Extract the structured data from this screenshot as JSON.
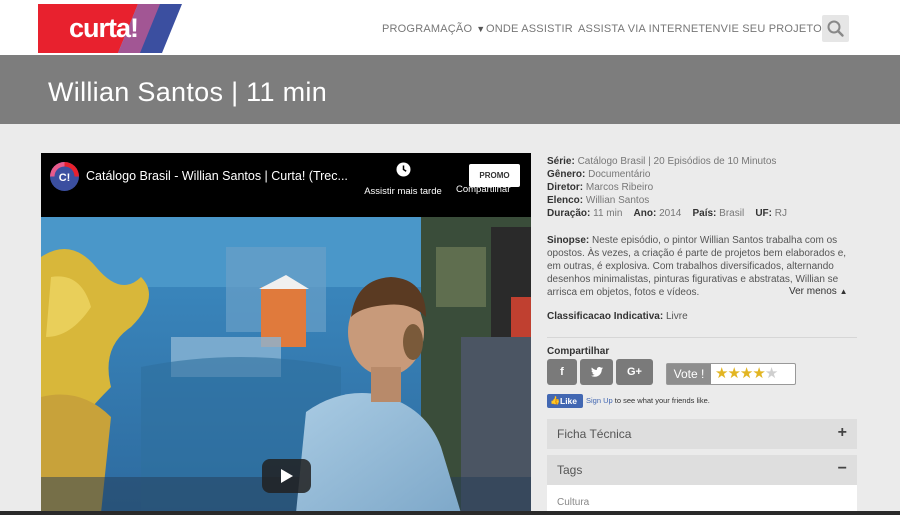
{
  "header": {
    "logo_text": "curta!",
    "nav": [
      "PROGRAMAÇÃO",
      "ONDE ASSISTIR",
      "ASSISTA VIA INTERNET",
      "ENVIE SEU PROJETO"
    ],
    "search_icon": "search-icon"
  },
  "page": {
    "title": "Willian Santos | 11 min"
  },
  "video": {
    "channel_icon_text": "C!",
    "title": "Catálogo Brasil - Willian Santos | Curta! (Trec...",
    "watch_later": "Assistir mais tarde",
    "promo": "PROMO",
    "share": "Compartilhar"
  },
  "info": {
    "serie_label": "Série:",
    "serie": "Catálogo Brasil | 20 Episódios de 10 Minutos",
    "genero_label": "Gênero:",
    "genero": "Documentário",
    "diretor_label": "Diretor:",
    "diretor": "Marcos Ribeiro",
    "elenco_label": "Elenco:",
    "elenco": "Willian Santos",
    "duracao_label": "Duração:",
    "duracao": "11 min",
    "ano_label": "Ano:",
    "ano": "2014",
    "pais_label": "País:",
    "pais": "Brasil",
    "uf_label": "UF:",
    "uf": "RJ"
  },
  "synopsis": {
    "label": "Sinopse:",
    "text": "Neste episódio, o pintor Willian Santos trabalha com os opostos. Às vezes, a criação é parte de projetos bem elaborados e, em outras, é explosiva. Com trabalhos diversificados, alternando desenhos minimalistas, pinturas figurativas e abstratas, Willian se arrisca em objetos, fotos e vídeos.",
    "toggle": "Ver menos"
  },
  "classification": {
    "label": "Classificacao Indicativa:",
    "value": "Livre"
  },
  "share": {
    "title": "Compartilhar",
    "facebook": "f",
    "twitter": "twitter-icon",
    "google": "G+"
  },
  "vote": {
    "label": "Vote !",
    "rating": 4,
    "max": 5
  },
  "facebook_like": {
    "button": "Like",
    "signup": "Sign Up",
    "text": " to see what your friends like."
  },
  "accordion": [
    {
      "title": "Ficha Técnica",
      "state": "+"
    },
    {
      "title": "Tags",
      "state": "−"
    }
  ],
  "tags": [
    "Cultura"
  ],
  "colors": {
    "brand_red": "#e8212e",
    "brand_blue": "#3b4fa0",
    "hero_gray": "#7d7d7d",
    "star_gold": "#e2b522"
  }
}
